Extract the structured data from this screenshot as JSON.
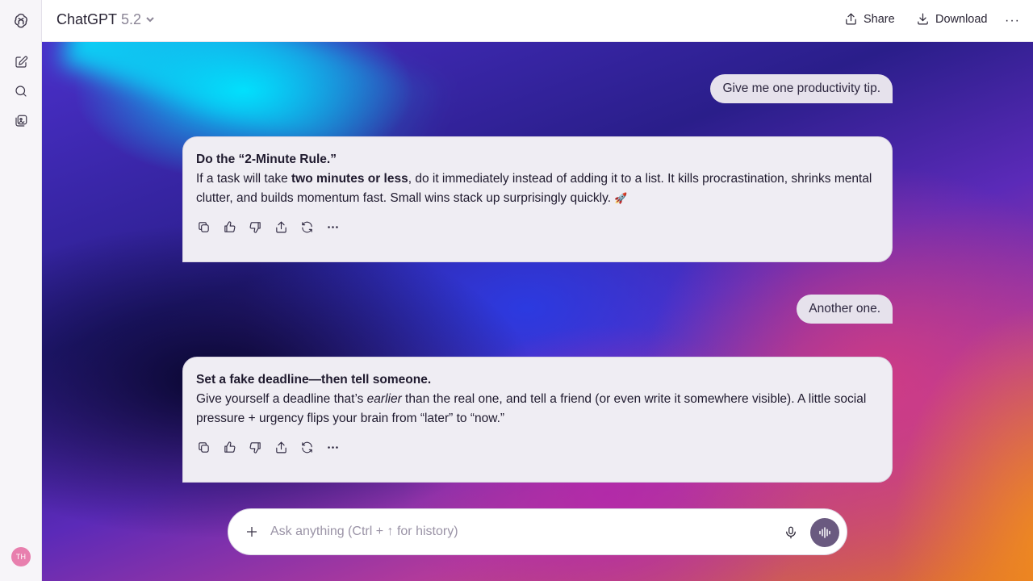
{
  "sidebar": {
    "logo_icon": "chatgpt-logo-icon",
    "new_chat_icon": "new-chat-icon",
    "search_icon": "search-icon",
    "library_icon": "library-icon",
    "avatar_initials": "TH"
  },
  "header": {
    "model_name": "ChatGPT",
    "model_version": "5.2",
    "share_label": "Share",
    "download_label": "Download",
    "more_label": "···"
  },
  "conversation": {
    "messages": [
      {
        "role": "user",
        "text": "Give me one productivity tip."
      },
      {
        "role": "assistant",
        "title": "Do the “2-Minute Rule.”",
        "text_pre": "If a task will take ",
        "text_bold": "two minutes or less",
        "text_post": ", do it immediately instead of adding it to a list. It kills procrastination, shrinks mental clutter, and builds momentum fast. Small wins stack up surprisingly quickly. ",
        "emoji": "🚀"
      },
      {
        "role": "user",
        "text": "Another one."
      },
      {
        "role": "assistant",
        "title": "Set a fake deadline—then tell someone.",
        "text_pre": "Give yourself a deadline that’s ",
        "text_italic": "earlier",
        "text_post": " than the real one, and tell a friend (or even write it somewhere visible). A little social pressure + urgency flips your brain from “later” to “now.”"
      }
    ],
    "message_actions": [
      "copy-icon",
      "thumbs-up-icon",
      "thumbs-down-icon",
      "share-icon",
      "regenerate-icon",
      "more-icon"
    ]
  },
  "composer": {
    "placeholder": "Ask anything (Ctrl + ↑ for history)",
    "value": ""
  },
  "colors": {
    "accent": "#6a5a80",
    "avatar": "#e87fae"
  }
}
